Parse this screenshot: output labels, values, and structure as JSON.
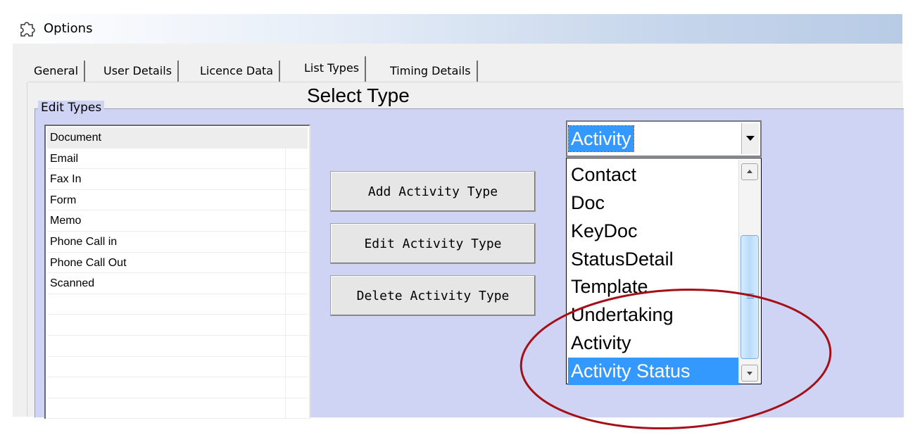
{
  "window": {
    "title": "Options"
  },
  "tabs": [
    {
      "label": "General"
    },
    {
      "label": "User Details"
    },
    {
      "label": "Licence Data"
    },
    {
      "label": "List Types",
      "selected": true
    },
    {
      "label": "Timing Details"
    }
  ],
  "group": {
    "label": "Edit Types"
  },
  "type_list": {
    "items": [
      "Document",
      "Email",
      "Fax In",
      "Form",
      "Memo",
      "Phone Call in",
      "Phone Call Out",
      "Scanned",
      "",
      "",
      "",
      "",
      "",
      ""
    ]
  },
  "select": {
    "label": "Select Type",
    "value": "Activity",
    "options": [
      "Contact",
      "Doc",
      "KeyDoc",
      "StatusDetail",
      "Template",
      "Undertaking",
      "Activity",
      "Activity Status"
    ],
    "highlighted": "Activity Status"
  },
  "buttons": {
    "add": "Add Activity Type",
    "edit": "Edit Activity Type",
    "delete": "Delete Activity Type"
  },
  "colors": {
    "group_bg": "#cfd4f4",
    "highlight": "#3399ff",
    "annotation": "#a50f17"
  }
}
